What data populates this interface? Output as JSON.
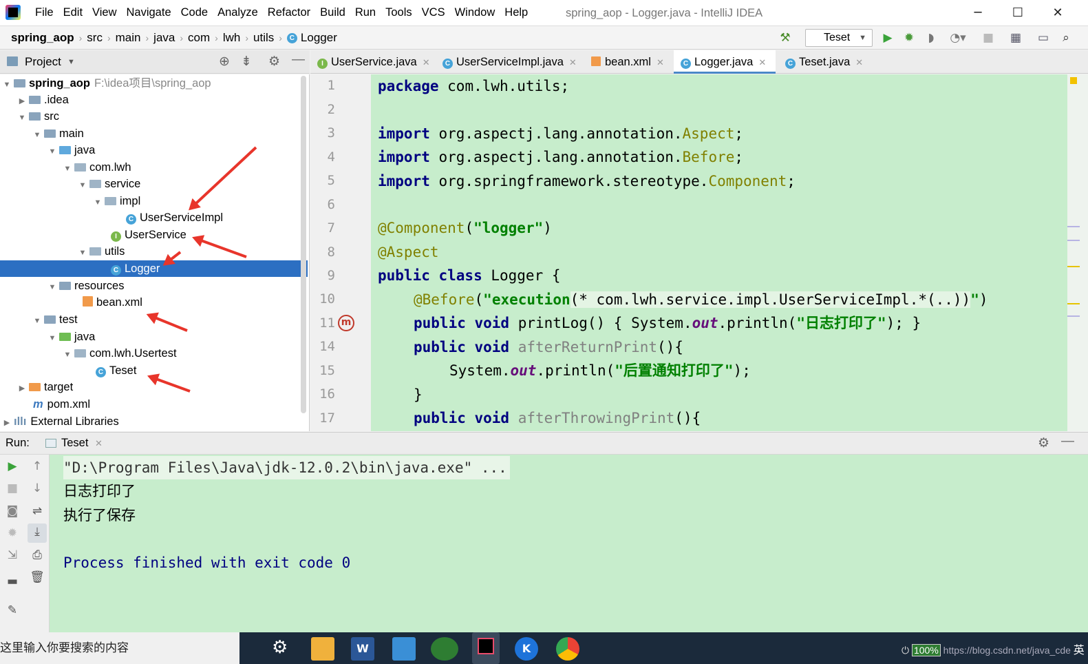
{
  "window": {
    "title": "spring_aop - Logger.java - IntelliJ IDEA",
    "menu": [
      "File",
      "Edit",
      "View",
      "Navigate",
      "Code",
      "Analyze",
      "Refactor",
      "Build",
      "Run",
      "Tools",
      "VCS",
      "Window",
      "Help"
    ],
    "minimize": "─",
    "maximize": "☐",
    "close": "✕"
  },
  "breadcrumb": [
    "spring_aop",
    "src",
    "main",
    "java",
    "com",
    "lwh",
    "utils",
    "Logger"
  ],
  "toolbar": {
    "run_config": "Teset",
    "icons": [
      "hammer-icon",
      "run-icon",
      "debug-icon",
      "coverage-icon",
      "profile-icon",
      "stop-icon",
      "project-structure-icon",
      "layout-icon",
      "search-icon"
    ]
  },
  "project_panel": {
    "title": "Project",
    "root_name": "spring_aop",
    "root_path": "F:\\idea项目\\spring_aop",
    "items": [
      {
        "label": ".idea"
      },
      {
        "label": "src"
      },
      {
        "label": "main"
      },
      {
        "label": "java"
      },
      {
        "label": "com.lwh"
      },
      {
        "label": "service"
      },
      {
        "label": "impl"
      },
      {
        "label": "UserServiceImpl"
      },
      {
        "label": "UserService"
      },
      {
        "label": "utils"
      },
      {
        "label": "Logger"
      },
      {
        "label": "resources"
      },
      {
        "label": "bean.xml"
      },
      {
        "label": "test"
      },
      {
        "label": "java"
      },
      {
        "label": "com.lwh.Usertest"
      },
      {
        "label": "Teset"
      },
      {
        "label": "target"
      },
      {
        "label": "pom.xml"
      },
      {
        "label": "External Libraries"
      }
    ]
  },
  "tabs": [
    {
      "label": "UserService.java"
    },
    {
      "label": "UserServiceImpl.java"
    },
    {
      "label": "bean.xml"
    },
    {
      "label": "Logger.java"
    },
    {
      "label": "Teset.java"
    }
  ],
  "line_numbers": [
    "1",
    "2",
    "3",
    "4",
    "5",
    "6",
    "7",
    "8",
    "9",
    "10",
    "11",
    "14",
    "15",
    "16",
    "17"
  ],
  "code": {
    "l1_kw": "package",
    "l1_rest": " com.lwh.utils;",
    "l3_kw": "import",
    "l3_pkg": " org.aspectj.lang.annotation.",
    "l3_cls": "Aspect",
    "l3_end": ";",
    "l4_kw": "import",
    "l4_pkg": " org.aspectj.lang.annotation.",
    "l4_cls": "Before",
    "l4_end": ";",
    "l5_kw": "import",
    "l5_pkg": " org.springframework.stereotype.",
    "l5_cls": "Component",
    "l5_end": ";",
    "l7_an": "@Component",
    "l7_p1": "(",
    "l7_str": "\"logger\"",
    "l7_p2": ")",
    "l8_an": "@Aspect",
    "l9_kw": "public class",
    "l9_rest": " Logger {",
    "l10_an": "@Before",
    "l10_p1": "(",
    "l10_str1": "\"execution",
    "l10_mid": "(* com.lwh.service.impl.UserServiceImpl.*(..))",
    "l10_str2": "\"",
    "l10_p2": ")",
    "l11_kw": "public void",
    "l11_a": " printLog() { System.",
    "l11_out": "out",
    "l11_b": ".println(",
    "l11_str": "\"日志打印了\"",
    "l11_c": "); }",
    "l14_kw": "public void",
    "l14_name": " afterReturnPrint",
    "l14_rest": "(){",
    "l15_a": "System.",
    "l15_out": "out",
    "l15_b": ".println(",
    "l15_str": "\"后置通知打印了\"",
    "l15_c": ");",
    "l16": "}",
    "l17_kw": "public void",
    "l17_name": " afterThrowingPrint",
    "l17_rest": "(){"
  },
  "run_panel": {
    "label": "Run:",
    "tab": "Teset",
    "output": [
      "\"D:\\Program Files\\Java\\jdk-12.0.2\\bin\\java.exe\" ...",
      "日志打印了",
      "执行了保存",
      "",
      "Process finished with exit code 0"
    ]
  },
  "taskbar": {
    "search_placeholder": "这里输入你要搜索的内容",
    "battery": "100%",
    "watermark": "https://blog.csdn.net/java_cde",
    "ime": "英"
  }
}
